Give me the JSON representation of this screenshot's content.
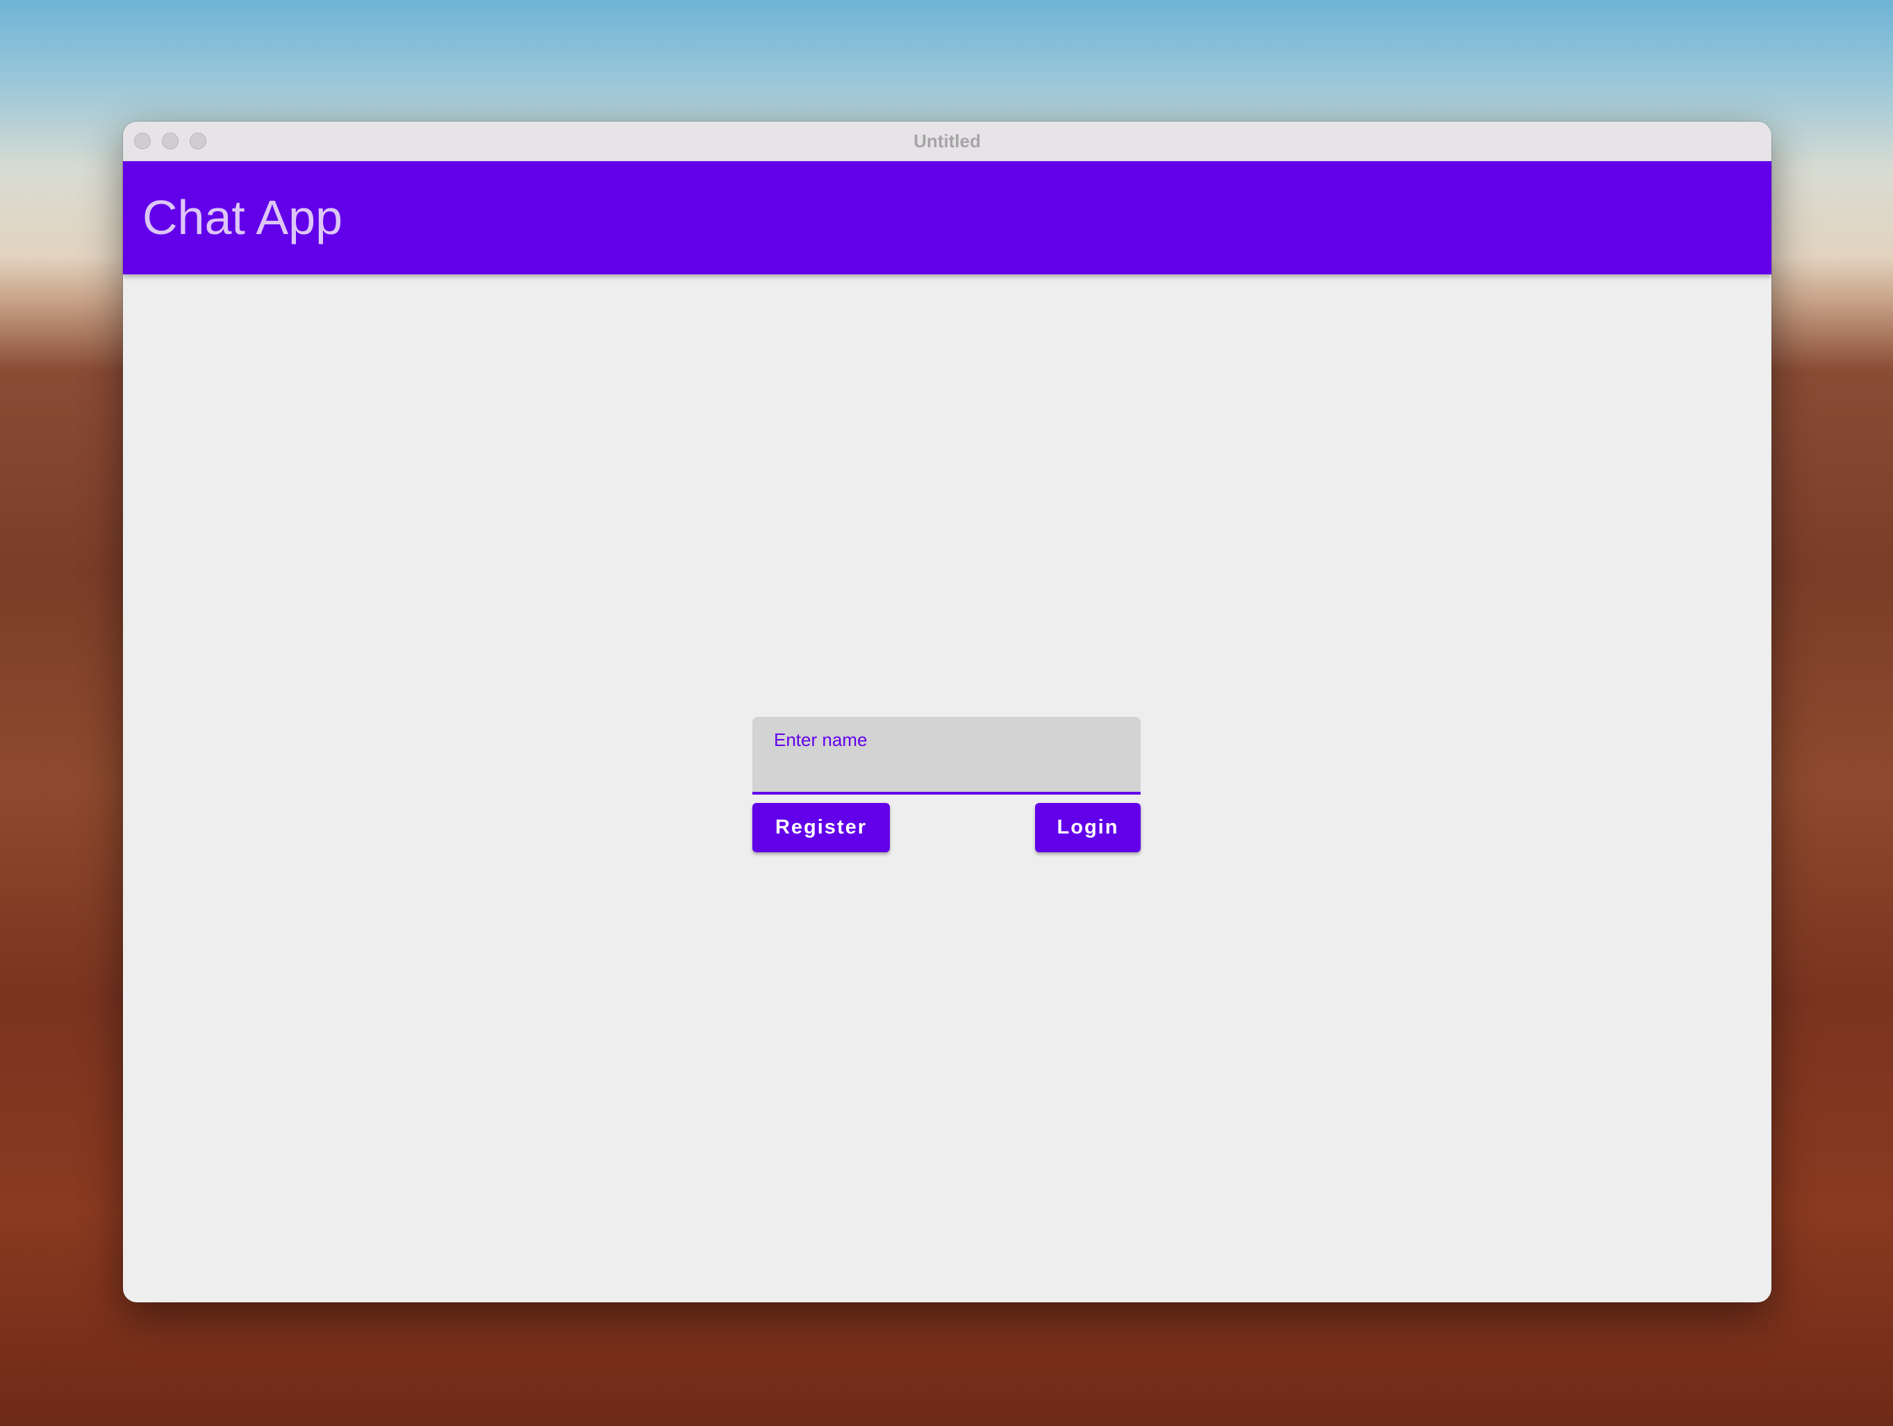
{
  "window": {
    "title": "Untitled"
  },
  "appbar": {
    "title": "Chat App",
    "color": "#6200ea"
  },
  "login": {
    "name_label": "Enter name",
    "name_value": "",
    "register_label": "Register",
    "login_label": "Login"
  }
}
